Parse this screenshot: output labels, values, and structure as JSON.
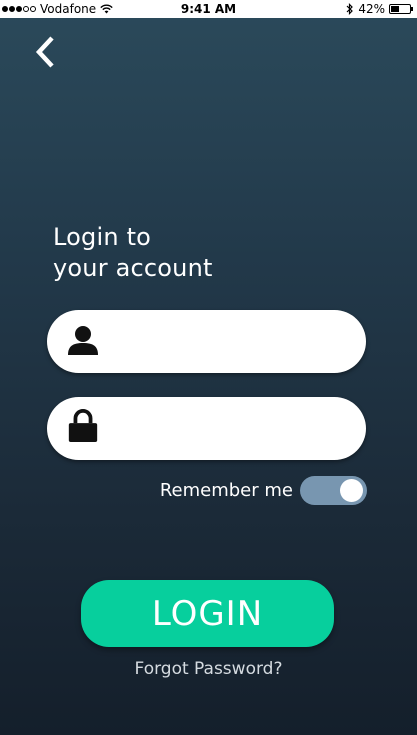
{
  "status_bar": {
    "carrier": "Vodafone",
    "time": "9:41 AM",
    "battery": "42%",
    "battery_level": 0.42,
    "signal_bars_filled": 3,
    "signal_bars_total": 5
  },
  "screen": {
    "title_line1": "Login to",
    "title_line2": "your account"
  },
  "form": {
    "username_value": "",
    "password_value": "",
    "remember_label": "Remember me",
    "remember_on": true,
    "login_label": "LOGIN",
    "forgot_label": "Forgot Password?"
  },
  "icons": {
    "back": "chevron-left-icon",
    "user": "user-icon",
    "lock": "lock-icon",
    "wifi": "wifi-icon",
    "bluetooth": "bluetooth-icon",
    "battery": "battery-icon"
  },
  "colors": {
    "accent": "#07cf9d",
    "toggle": "#7896b0"
  }
}
